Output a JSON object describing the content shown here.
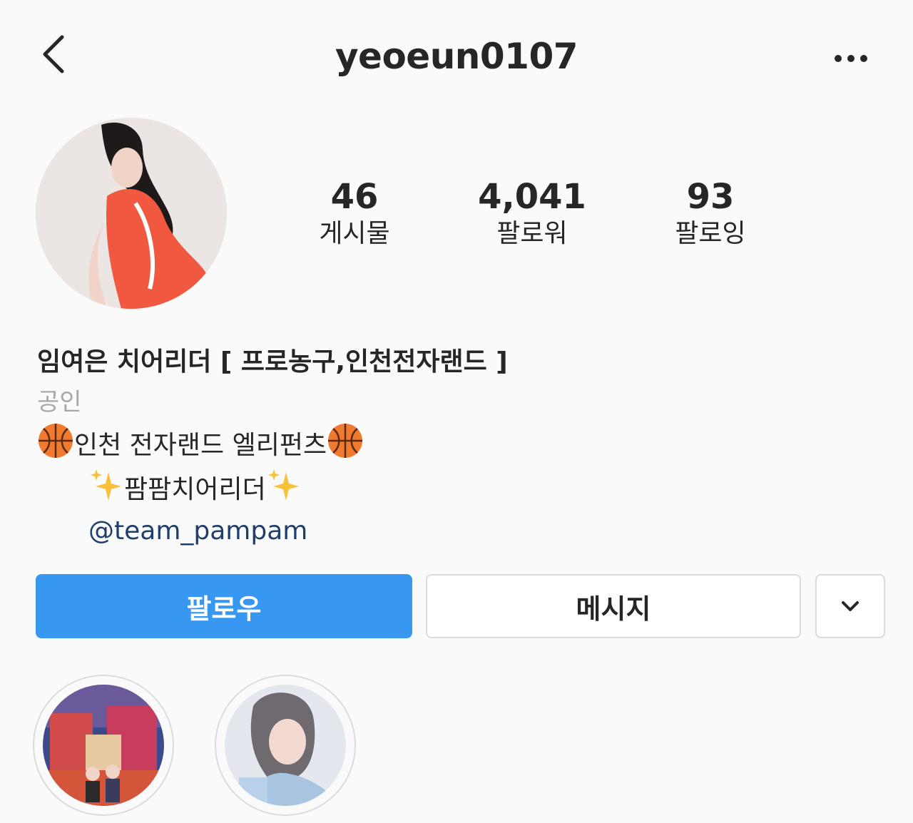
{
  "header": {
    "username": "yeoeun0107",
    "back_icon": "chevron-left-icon",
    "more_icon": "more-horizontal-icon"
  },
  "profile": {
    "avatar": "profile-photo",
    "stats": [
      {
        "value": "46",
        "label": "게시물"
      },
      {
        "value": "4,041",
        "label": "팔로워"
      },
      {
        "value": "93",
        "label": "팔로잉"
      }
    ]
  },
  "bio": {
    "name": "임여은 치어리더 [ 프로농구,인천전자랜드 ]",
    "category": "공인",
    "line1": "인천 전자랜드 엘리펀츠",
    "line2": "팜팜치어리더",
    "mention": "@team_pampam"
  },
  "actions": {
    "follow_label": "팔로우",
    "message_label": "메시지",
    "dropdown_icon": "chevron-down-icon"
  },
  "highlights": [
    {
      "name": "highlight-1"
    },
    {
      "name": "highlight-2"
    }
  ],
  "colors": {
    "follow_button": "#3897f0",
    "link": "#1d3f6e",
    "category": "#a8a8a8",
    "border": "#dbdbdb"
  }
}
